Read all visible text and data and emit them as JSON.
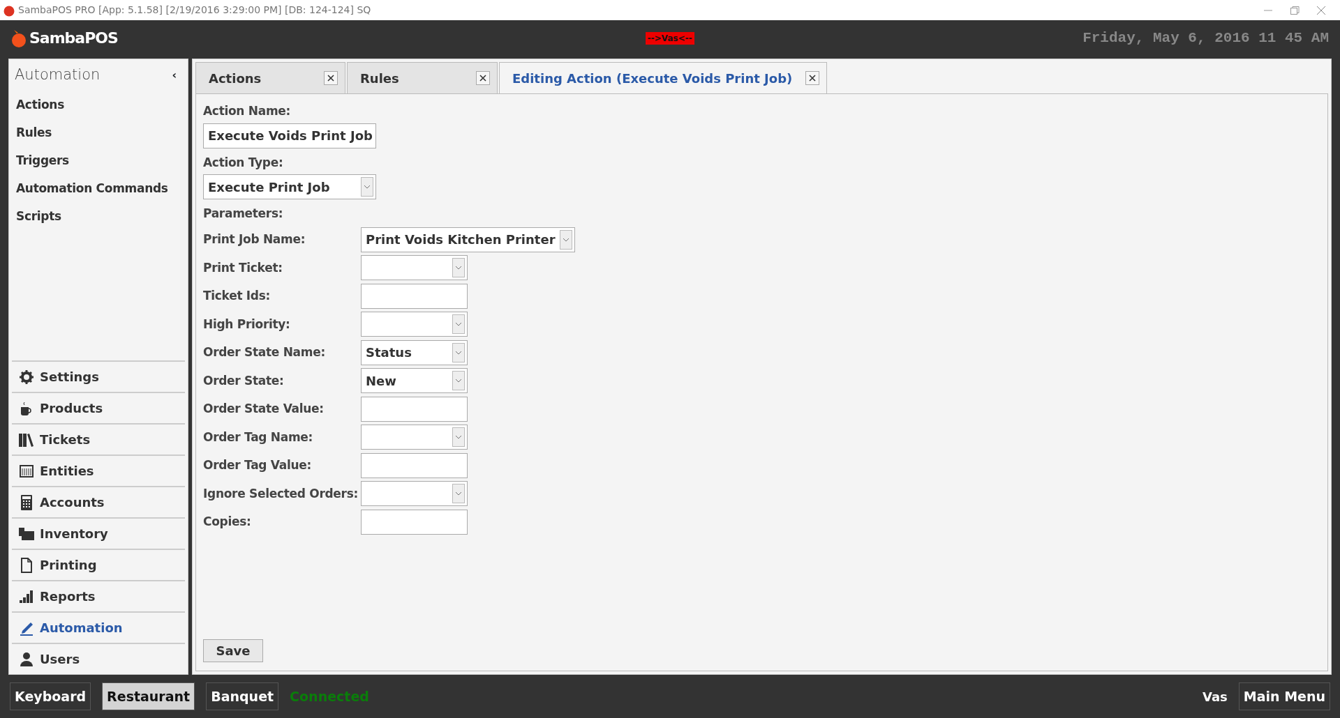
{
  "window": {
    "title": "SambaPOS PRO [App: 5.1.58] [2/19/2016 3:29:00 PM] [DB: 124-124] SQ"
  },
  "header": {
    "logo": "SambaPOS",
    "alert": "-->Vas<--",
    "datetime": "Friday, May 6, 2016 11 45 AM"
  },
  "sidebar": {
    "title": "Automation",
    "collapse": "‹",
    "items": [
      "Actions",
      "Rules",
      "Triggers",
      "Automation Commands",
      "Scripts"
    ],
    "nav": [
      {
        "label": "Settings",
        "selected": false
      },
      {
        "label": "Products",
        "selected": false
      },
      {
        "label": "Tickets",
        "selected": false
      },
      {
        "label": "Entities",
        "selected": false
      },
      {
        "label": "Accounts",
        "selected": false
      },
      {
        "label": "Inventory",
        "selected": false
      },
      {
        "label": "Printing",
        "selected": false
      },
      {
        "label": "Reports",
        "selected": false
      },
      {
        "label": "Automation",
        "selected": true
      },
      {
        "label": "Users",
        "selected": false
      }
    ]
  },
  "tabs": [
    {
      "label": "Actions",
      "selected": false
    },
    {
      "label": "Rules",
      "selected": false
    },
    {
      "label": "Editing Action (Execute Voids Print Job)",
      "selected": true
    }
  ],
  "form": {
    "action_name": {
      "label": "Action Name:",
      "value": "Execute Voids Print Job"
    },
    "action_type": {
      "label": "Action Type:",
      "value": "Execute Print Job"
    },
    "parameters_label": "Parameters:",
    "parameters": [
      {
        "label": "Print Job Name:",
        "kind": "select",
        "value": "Print Voids Kitchen Printer"
      },
      {
        "label": "Print Ticket:",
        "kind": "select"
      },
      {
        "label": "Ticket Ids:",
        "kind": "text"
      },
      {
        "label": "High Priority:",
        "kind": "select"
      },
      {
        "label": "Order State Name:",
        "kind": "select",
        "value": "Status"
      },
      {
        "label": "Order State:",
        "kind": "select",
        "value": "New"
      },
      {
        "label": "Order State Value:",
        "kind": "text"
      },
      {
        "label": "Order Tag Name:",
        "kind": "select"
      },
      {
        "label": "Order Tag Value:",
        "kind": "text"
      },
      {
        "label": "Ignore Selected Orders:",
        "kind": "select"
      },
      {
        "label": "Copies:",
        "kind": "text"
      }
    ],
    "save": "Save"
  },
  "status_bar": {
    "buttons": [
      {
        "label": "Keyboard",
        "selected": false
      },
      {
        "label": "Restaurant",
        "selected": true
      },
      {
        "label": "Banquet",
        "selected": false
      }
    ],
    "connection": "Connected",
    "user": "Vas",
    "main_menu": "Main Menu"
  }
}
